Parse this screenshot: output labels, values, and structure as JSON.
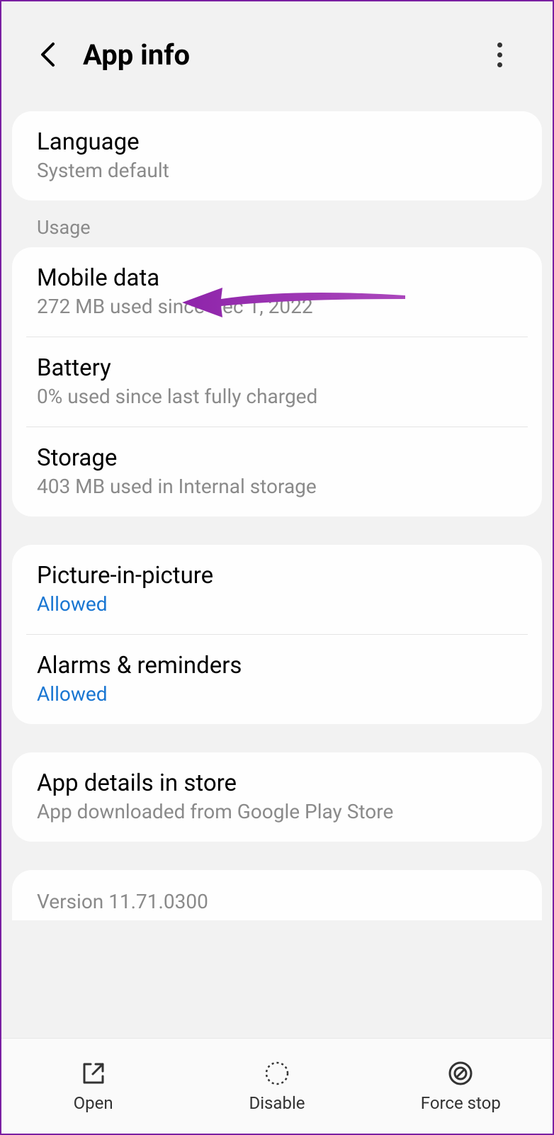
{
  "header": {
    "title": "App info"
  },
  "cards": {
    "language": {
      "title": "Language",
      "sub": "System default"
    }
  },
  "section_usage": "Usage",
  "usage": {
    "mobile_data": {
      "title": "Mobile data",
      "sub": "272 MB used since Dec 1, 2022"
    },
    "battery": {
      "title": "Battery",
      "sub": "0% used since last fully charged"
    },
    "storage": {
      "title": "Storage",
      "sub": "403 MB used in Internal storage"
    }
  },
  "perms": {
    "pip": {
      "title": "Picture-in-picture",
      "sub": "Allowed"
    },
    "alarms": {
      "title": "Alarms & reminders",
      "sub": "Allowed"
    }
  },
  "store": {
    "title": "App details in store",
    "sub": "App downloaded from Google Play Store"
  },
  "version": "Version 11.71.0300",
  "bottom": {
    "open": "Open",
    "disable": "Disable",
    "force_stop": "Force stop"
  }
}
